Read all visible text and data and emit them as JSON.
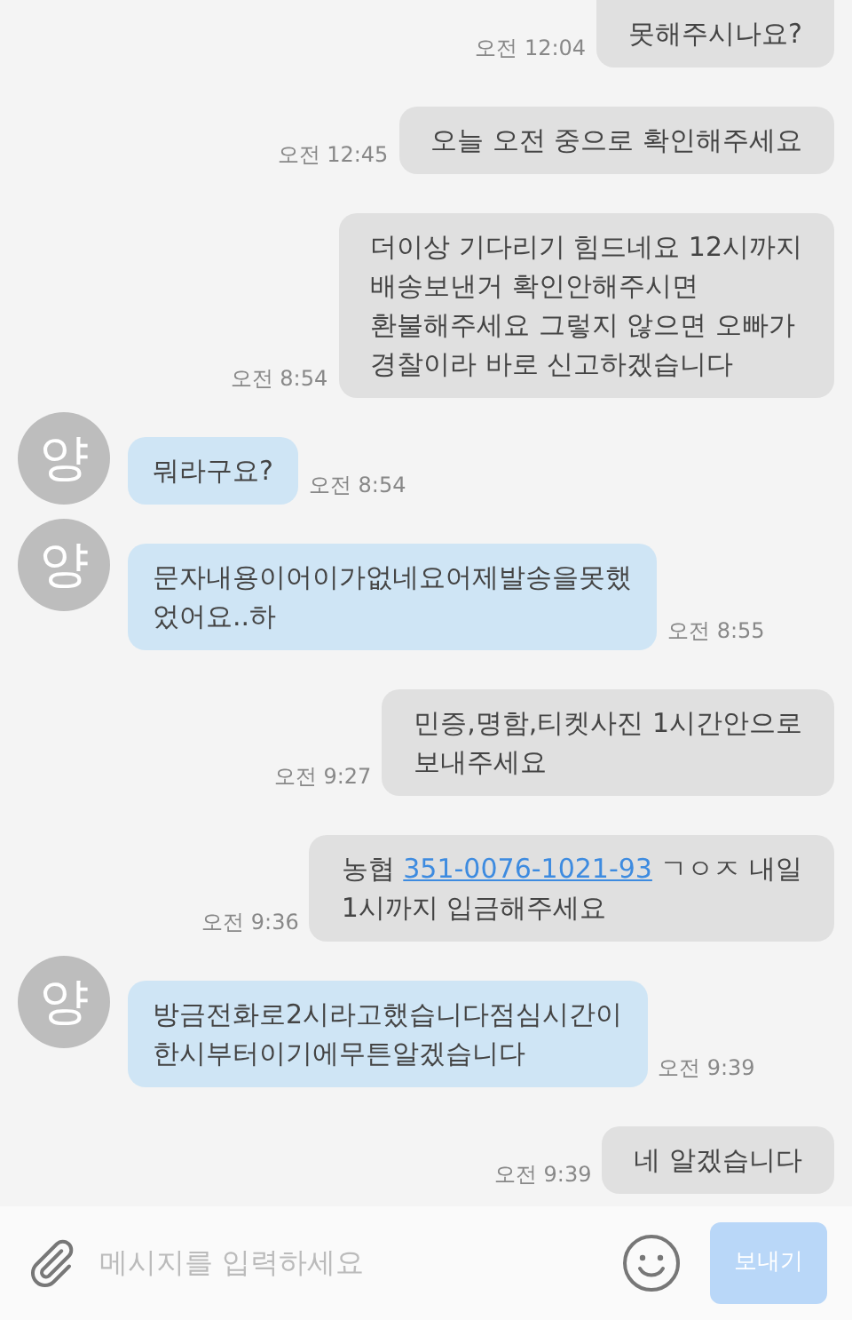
{
  "messages": [
    {
      "kind": "sent",
      "lines": [
        [
          {
            "text": "못해주시나요?"
          }
        ]
      ],
      "time": "오전 12:04",
      "cut_top": true
    },
    {
      "kind": "sent",
      "lines": [
        [
          {
            "text": "오늘 오전 중으로 확인해주세요"
          }
        ]
      ],
      "time": "오전 12:45"
    },
    {
      "kind": "sent",
      "lines": [
        [
          {
            "text": "더이상 기다리기 힘드네요 12시까지"
          }
        ],
        [
          {
            "text": "배송보낸거 확인안해주시면"
          }
        ],
        [
          {
            "text": "환불해주세요 그렇지 않으면 오빠가"
          }
        ],
        [
          {
            "text": "경찰이라 바로 신고하겠습니다"
          }
        ]
      ],
      "time": "오전 8:54"
    },
    {
      "kind": "received",
      "avatar": "양",
      "lines": [
        [
          {
            "text": "뭐라구요?"
          }
        ]
      ],
      "time": "오전 8:54"
    },
    {
      "kind": "received",
      "avatar": "양",
      "lines": [
        [
          {
            "text": "문자내용이어이가없네요어제발송을못했"
          }
        ],
        [
          {
            "text": "었어요..하"
          }
        ]
      ],
      "time": "오전 8:55"
    },
    {
      "kind": "sent",
      "lines": [
        [
          {
            "text": "민증,명함,티켓사진 1시간안으로"
          }
        ],
        [
          {
            "text": "보내주세요"
          }
        ]
      ],
      "time": "오전 9:27"
    },
    {
      "kind": "sent",
      "lines": [
        [
          {
            "text": "농협 "
          },
          {
            "text": "351-0076-1021-93",
            "link": true
          },
          {
            "text": " ㄱㅇㅈ 내일"
          }
        ],
        [
          {
            "text": "1시까지 입금해주세요"
          }
        ]
      ],
      "time": "오전 9:36"
    },
    {
      "kind": "received",
      "avatar": "양",
      "lines": [
        [
          {
            "text": "방금전화로2시라고했습니다점심시간이"
          }
        ],
        [
          {
            "text": "한시부터이기에무튼알겠습니다"
          }
        ]
      ],
      "time": "오전 9:39"
    },
    {
      "kind": "sent",
      "lines": [
        [
          {
            "text": "네 알겠습니다"
          }
        ]
      ],
      "time": "오전 9:39"
    }
  ],
  "composer": {
    "placeholder": "메시지를 입력하세요",
    "send_label": "보내기",
    "send_disabled": true
  }
}
